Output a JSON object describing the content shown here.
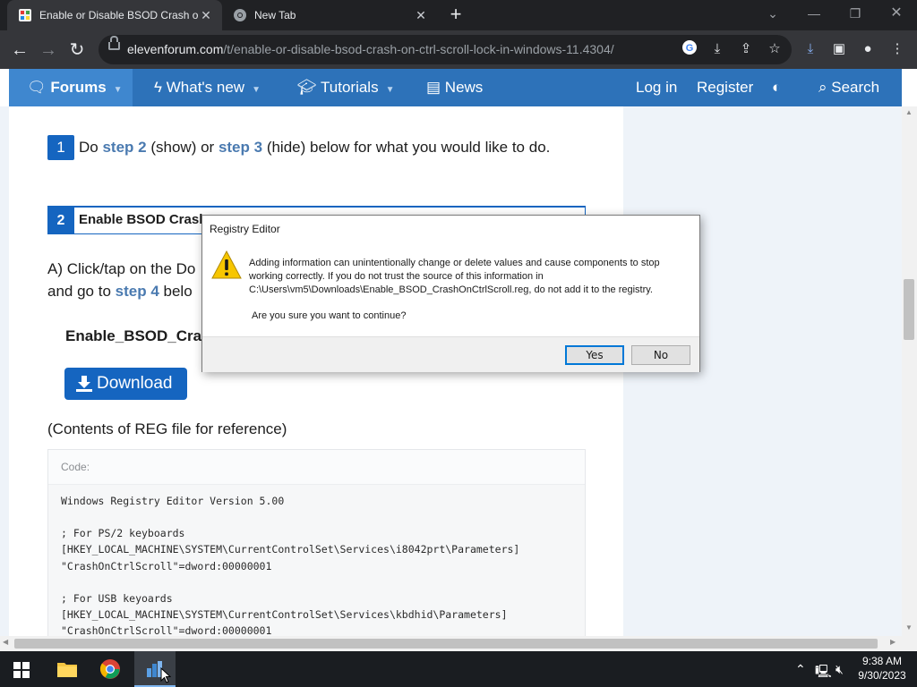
{
  "browser": {
    "tabs": [
      {
        "title": "Enable or Disable BSOD Crash on",
        "active": true
      },
      {
        "title": "New Tab",
        "active": false
      }
    ],
    "url_host": "elevenforum.com",
    "url_path": "/t/enable-or-disable-bsod-crash-on-ctrl-scroll-lock-in-windows-11.4304/"
  },
  "site_nav": {
    "forums": "Forums",
    "whats_new": "What's new",
    "tutorials": "Tutorials",
    "news": "News",
    "login": "Log in",
    "register": "Register",
    "search": "Search"
  },
  "content": {
    "step1_num": "1",
    "step1_do": "Do",
    "step1_link2": "step 2",
    "step1_mid": "(show) or",
    "step1_link3": "step 3",
    "step1_end": "(hide) below for what you would like to do.",
    "sec2_num": "2",
    "sec2_title": "Enable BSOD Crash",
    "a_line1": "A) Click/tap on the Do",
    "a_line2_pre": "and go to",
    "a_line2_link": "step 4",
    "a_line2_post": "belo",
    "filename": "Enable_BSOD_Cras",
    "download": "Download",
    "contents_label": "(Contents of REG file for reference)",
    "code_label": "Code:",
    "code_lines": [
      "Windows Registry Editor Version 5.00",
      "",
      "; For PS/2 keyboards",
      "[HKEY_LOCAL_MACHINE\\SYSTEM\\CurrentControlSet\\Services\\i8042prt\\Parameters]",
      "\"CrashOnCtrlScroll\"=dword:00000001",
      "",
      "; For USB keyoards",
      "[HKEY_LOCAL_MACHINE\\SYSTEM\\CurrentControlSet\\Services\\kbdhid\\Parameters]",
      "\"CrashOnCtrlScroll\"=dword:00000001"
    ]
  },
  "dialog": {
    "title": "Registry Editor",
    "message": "Adding information can unintentionally change or delete values and cause components to stop working correctly. If you do not trust the source of this information in C:\\Users\\vm5\\Downloads\\Enable_BSOD_CrashOnCtrlScroll.reg, do not add it to the registry.",
    "question": "Are you sure you want to continue?",
    "yes": "Yes",
    "no": "No"
  },
  "taskbar": {
    "time": "9:38 AM",
    "date": "9/30/2023"
  },
  "colors": {
    "accent": "#1565c0",
    "nav": "#2d72b9",
    "chrome_dark": "#202124"
  }
}
